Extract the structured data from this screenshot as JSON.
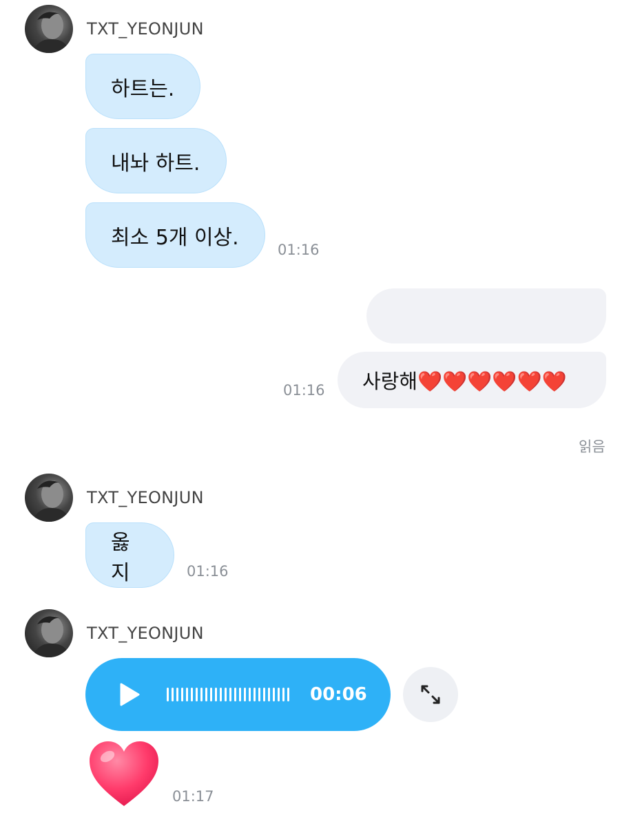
{
  "groups": [
    {
      "sender": "TXT_YEONJUN",
      "messages": [
        "하트는.",
        "내놔 하트.",
        "최소 5개 이상."
      ],
      "time": "01:16"
    },
    {
      "sender": "TXT_YEONJUN",
      "messages": [
        "옳지"
      ],
      "time": "01:16"
    },
    {
      "sender": "TXT_YEONJUN",
      "voice": {
        "duration": "00:06",
        "play_icon": "play-icon",
        "expand_icon": "expand-icon"
      },
      "sticker_icon": "heart-sticker-icon",
      "time": "01:17"
    }
  ],
  "outgoing": {
    "blank_message": "",
    "message": "사랑해❤️❤️❤️❤️❤️❤️",
    "time": "01:16",
    "read_status": "읽음"
  },
  "colors": {
    "incoming_bubble": "#d4ecfd",
    "outgoing_bubble": "#f1f2f6",
    "voice_bubble": "#2eb1f7",
    "heart": "#ff3b6b"
  }
}
